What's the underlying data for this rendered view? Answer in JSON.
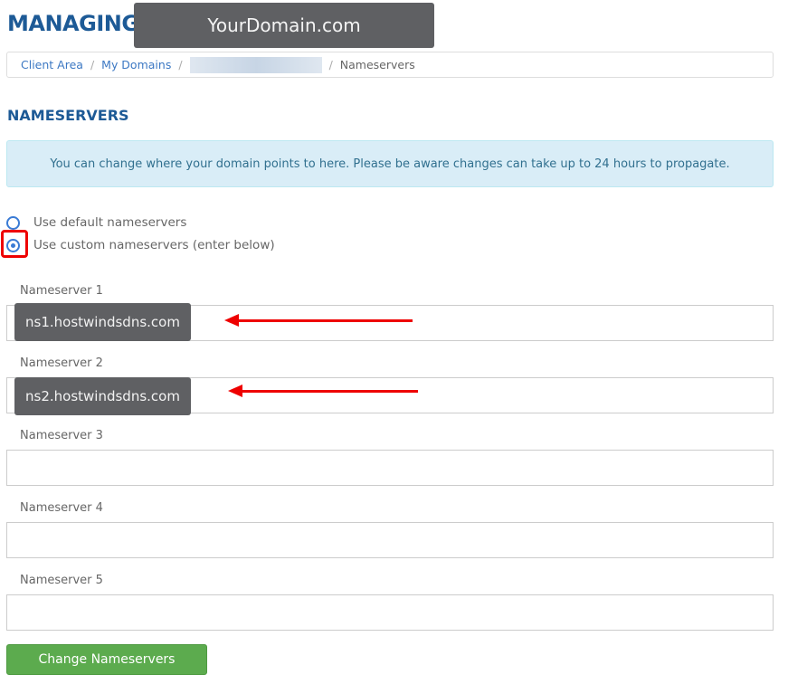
{
  "header": {
    "title": "MANAGING",
    "domain": "YourDomain.com"
  },
  "breadcrumb": {
    "items": [
      "Client Area",
      "My Domains"
    ],
    "current": "Nameservers"
  },
  "section_title": "NAMESERVERS",
  "alert": "You can change where your domain points to here. Please be aware changes can take up to 24 hours to propagate.",
  "options": {
    "default": "Use default nameservers",
    "custom": "Use custom nameservers (enter below)",
    "selected": "custom"
  },
  "nameservers": [
    {
      "label": "Nameserver 1",
      "value": "ns1.hostwindsdns.com"
    },
    {
      "label": "Nameserver 2",
      "value": "ns2.hostwindsdns.com"
    },
    {
      "label": "Nameserver 3",
      "value": ""
    },
    {
      "label": "Nameserver 4",
      "value": ""
    },
    {
      "label": "Nameserver 5",
      "value": ""
    }
  ],
  "submit_label": "Change Nameservers",
  "colors": {
    "accent": "#1d5a96",
    "button": "#5cab4e",
    "annotation": "#ee0000"
  }
}
